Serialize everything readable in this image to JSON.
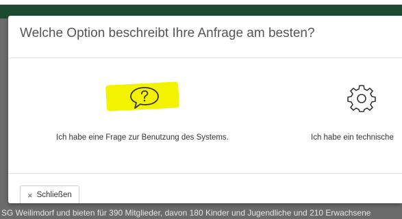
{
  "modal": {
    "title": "Welche Option beschreibt Ihre Anfrage am besten?",
    "options": [
      {
        "label": "Ich habe eine Frage zur Benutzung des Systems.",
        "icon": "question-bubble-icon",
        "highlighted": true
      },
      {
        "label": "Ich habe ein technische",
        "icon": "gear-icon"
      }
    ],
    "close_label": "Schließen",
    "close_icon": "×"
  },
  "background": {
    "footer_text": "SG Weilimdorf und bieten für 390 Mitglieder, davon 180 Kinder und Jugendliche und 210 Erwachsene"
  },
  "colors": {
    "highlight": "#f3f300",
    "page_header": "#1c4a30"
  }
}
